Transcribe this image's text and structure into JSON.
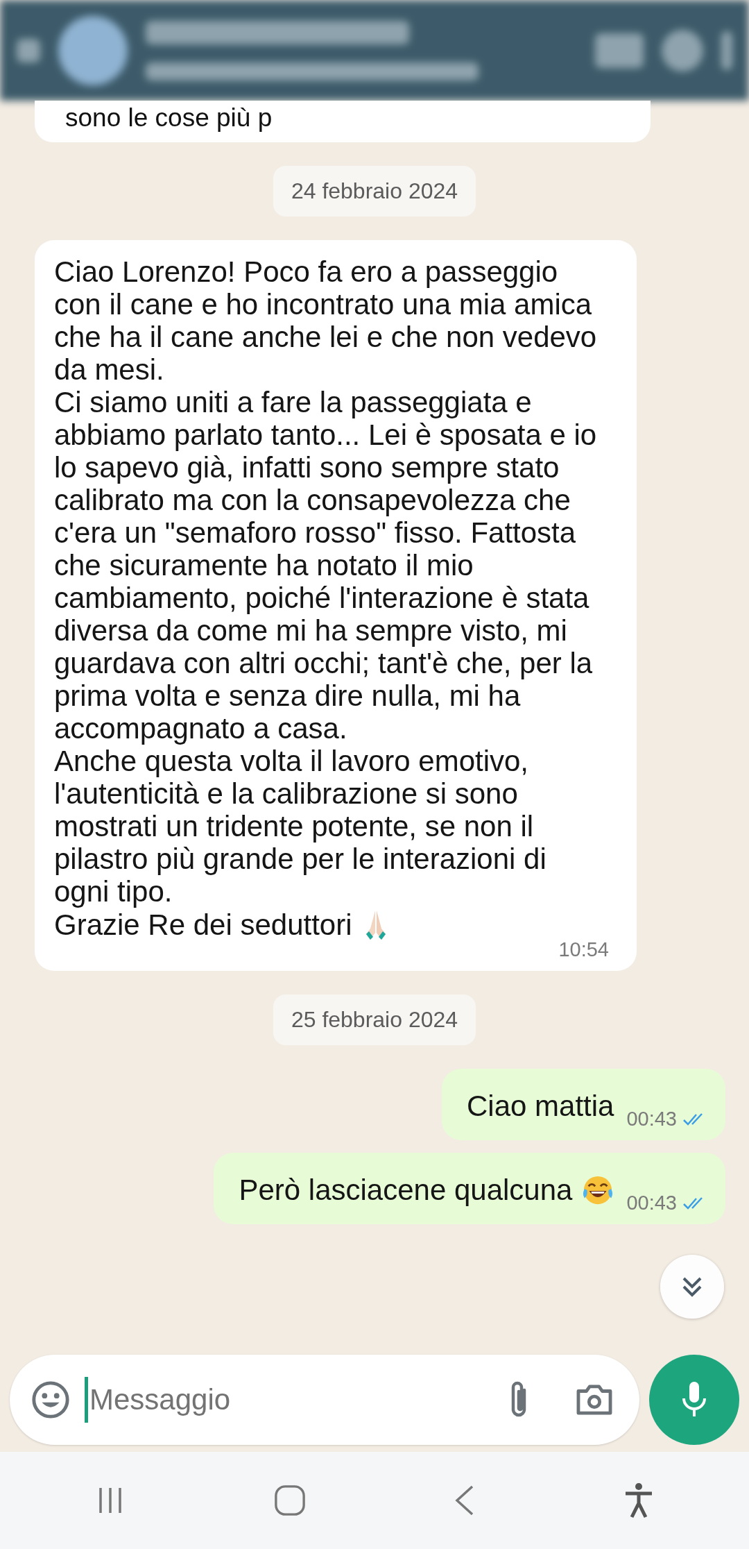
{
  "top_message": {
    "text": "sono le cose più p"
  },
  "messages": [
    {
      "kind": "date",
      "text": "24 febbraio 2024"
    },
    {
      "kind": "incoming",
      "paragraphs": [
        "Ciao Lorenzo! Poco fa ero a passeggio con il cane e ho incontrato una mia amica che ha il cane anche lei e che non vedevo da mesi.",
        "Ci siamo uniti a fare la passeggiata e abbiamo parlato tanto... Lei è sposata e io lo sapevo già, infatti sono sempre stato calibrato ma con la consapevolezza che c'era un \"semaforo rosso\" fisso. Fattosta che sicuramente ha notato il mio cambiamento, poiché l'interazione è stata diversa da come mi ha sempre visto, mi guardava con altri occhi; tant'è che, per la prima volta e senza dire nulla, mi ha accompagnato a casa.",
        "Anche questa volta il lavoro emotivo, l'autenticità e la calibrazione si sono mostrati un tridente potente, se non il pilastro più grande per le interazioni di ogni tipo.",
        "Grazie Re dei seduttori"
      ],
      "time": "10:54"
    },
    {
      "kind": "date",
      "text": "25 febbraio 2024"
    },
    {
      "kind": "outgoing",
      "paragraphs": [
        "Ciao mattia"
      ],
      "time": "00:43",
      "read": true
    },
    {
      "kind": "outgoing",
      "paragraphs": [
        "Però lasciacene qualcuna"
      ],
      "time": "00:43",
      "read": true
    }
  ],
  "composer": {
    "placeholder": "Messaggio"
  }
}
